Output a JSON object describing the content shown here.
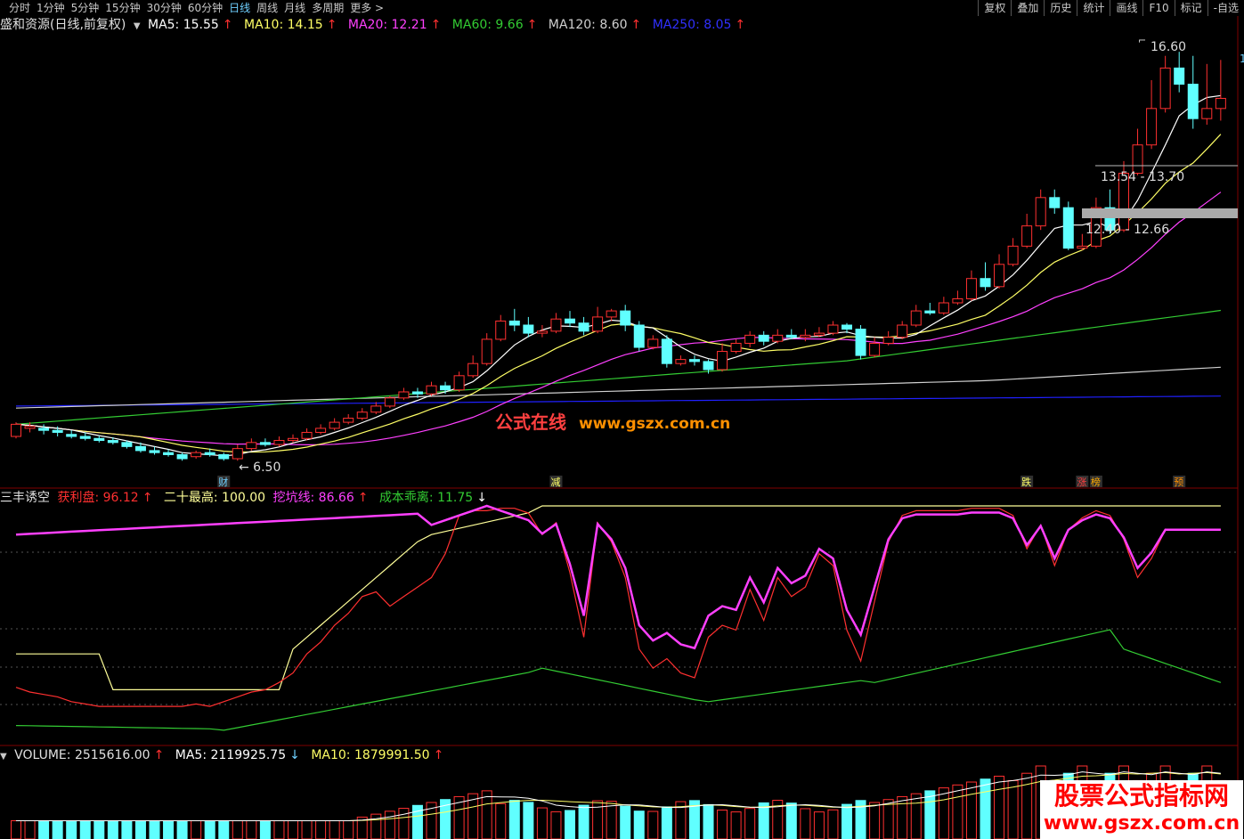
{
  "toolbar": {
    "periods": [
      "分时",
      "1分钟",
      "5分钟",
      "15分钟",
      "30分钟",
      "60分钟",
      "日线",
      "周线",
      "月线",
      "多周期",
      "更多"
    ],
    "active_period": "日线",
    "more_arrow": ">",
    "tools": [
      "复权",
      "叠加",
      "历史",
      "统计",
      "画线",
      "F10",
      "标记",
      "-自选"
    ]
  },
  "main_legend": {
    "title": "盛和资源(日线,前复权)",
    "ma5": "MA5: 15.55",
    "ma10": "MA10: 14.15",
    "ma20": "MA20: 12.21",
    "ma60": "MA60: 9.66",
    "ma120": "MA120: 8.60",
    "ma250": "MA250: 8.05",
    "arrow": "↑",
    "colors": {
      "ma5": "#ffffff",
      "ma10": "#ffff66",
      "ma20": "#ff40ff",
      "ma60": "#33cc33",
      "ma120": "#d0d0d0",
      "ma250": "#2020ff",
      "up": "#ff3030",
      "down": "#60ffff"
    }
  },
  "annotations": {
    "high": "16.60",
    "low": "6.50",
    "zone1": "13.54 - 13.70",
    "zone2": "12.40 - 12.66",
    "tags": [
      "财",
      "减",
      "跌",
      "涨",
      "榜",
      "预"
    ],
    "right_edge": "1"
  },
  "sub_legend": {
    "name": "三丰诱空",
    "profit": "获利盘: 96.12",
    "top20": "二十最高: 100.00",
    "pit": "挖坑线: 86.66",
    "cost": "成本乖离: 11.75",
    "up_arrow": "↑",
    "down_arrow": "↓"
  },
  "vol_legend": {
    "vol": "VOLUME: 2515616.00",
    "ma5": "MA5: 2119925.75",
    "ma10": "MA10: 1879991.50",
    "up_arrow": "↑",
    "down_arrow": "↓"
  },
  "watermarks": {
    "center_cn": "公式在线",
    "center_url": "www.gszx.com.cn",
    "corner_cn": "股票公式指标网",
    "corner_url": "www.gszx.com.cn"
  },
  "chart_data": {
    "type": "candlestick",
    "price_range": [
      6.0,
      17.0
    ],
    "candles": [
      [
        7.1,
        7.4,
        7.45,
        7.05
      ],
      [
        7.3,
        7.35,
        7.45,
        7.2
      ],
      [
        7.3,
        7.25,
        7.4,
        7.15
      ],
      [
        7.25,
        7.2,
        7.35,
        7.1
      ],
      [
        7.15,
        7.1,
        7.25,
        7.05
      ],
      [
        7.1,
        7.05,
        7.2,
        7.0
      ],
      [
        7.05,
        7.0,
        7.12,
        6.95
      ],
      [
        7.0,
        6.95,
        7.08,
        6.9
      ],
      [
        6.95,
        6.85,
        7.0,
        6.8
      ],
      [
        6.85,
        6.75,
        6.95,
        6.7
      ],
      [
        6.75,
        6.7,
        6.85,
        6.65
      ],
      [
        6.7,
        6.65,
        6.78,
        6.6
      ],
      [
        6.65,
        6.55,
        6.7,
        6.5
      ],
      [
        6.6,
        6.7,
        6.75,
        6.55
      ],
      [
        6.7,
        6.65,
        6.8,
        6.6
      ],
      [
        6.65,
        6.55,
        6.7,
        6.5
      ],
      [
        6.55,
        6.8,
        6.9,
        6.5
      ],
      [
        6.8,
        6.95,
        7.05,
        6.75
      ],
      [
        6.95,
        6.9,
        7.05,
        6.85
      ],
      [
        6.9,
        7.0,
        7.1,
        6.85
      ],
      [
        7.0,
        7.05,
        7.15,
        6.95
      ],
      [
        7.05,
        7.2,
        7.3,
        7.0
      ],
      [
        7.2,
        7.3,
        7.4,
        7.15
      ],
      [
        7.3,
        7.45,
        7.55,
        7.25
      ],
      [
        7.45,
        7.55,
        7.65,
        7.4
      ],
      [
        7.55,
        7.7,
        7.8,
        7.5
      ],
      [
        7.7,
        7.85,
        7.95,
        7.65
      ],
      [
        7.85,
        8.05,
        8.1,
        7.8
      ],
      [
        8.05,
        8.2,
        8.3,
        8.0
      ],
      [
        8.2,
        8.15,
        8.3,
        8.05
      ],
      [
        8.15,
        8.35,
        8.45,
        8.1
      ],
      [
        8.35,
        8.25,
        8.45,
        8.15
      ],
      [
        8.25,
        8.6,
        8.7,
        8.2
      ],
      [
        8.6,
        8.9,
        9.1,
        8.55
      ],
      [
        8.9,
        9.5,
        9.65,
        8.85
      ],
      [
        9.5,
        9.95,
        10.1,
        9.45
      ],
      [
        9.95,
        9.85,
        10.25,
        9.7
      ],
      [
        9.85,
        9.65,
        10.05,
        9.55
      ],
      [
        9.65,
        9.7,
        9.85,
        9.55
      ],
      [
        9.7,
        10.0,
        10.15,
        9.65
      ],
      [
        10.0,
        9.9,
        10.2,
        9.8
      ],
      [
        9.9,
        9.7,
        10.05,
        9.6
      ],
      [
        9.7,
        10.05,
        10.3,
        9.65
      ],
      [
        10.05,
        10.2,
        10.25,
        9.95
      ],
      [
        10.2,
        9.85,
        10.35,
        9.7
      ],
      [
        9.85,
        9.3,
        9.95,
        9.2
      ],
      [
        9.3,
        9.5,
        9.6,
        9.25
      ],
      [
        9.5,
        8.9,
        9.6,
        8.8
      ],
      [
        8.9,
        9.0,
        9.1,
        8.85
      ],
      [
        9.0,
        8.95,
        9.1,
        8.85
      ],
      [
        8.95,
        8.75,
        9.0,
        8.65
      ],
      [
        8.75,
        9.2,
        9.4,
        8.7
      ],
      [
        9.2,
        9.4,
        9.5,
        9.15
      ],
      [
        9.4,
        9.6,
        9.7,
        9.3
      ],
      [
        9.6,
        9.45,
        9.7,
        9.35
      ],
      [
        9.45,
        9.6,
        9.75,
        9.4
      ],
      [
        9.6,
        9.55,
        9.75,
        9.5
      ],
      [
        9.55,
        9.6,
        9.75,
        9.45
      ],
      [
        9.6,
        9.65,
        9.8,
        9.55
      ],
      [
        9.65,
        9.85,
        9.95,
        9.6
      ],
      [
        9.85,
        9.75,
        9.9,
        9.65
      ],
      [
        9.75,
        9.1,
        9.85,
        9.0
      ],
      [
        9.1,
        9.4,
        9.55,
        9.05
      ],
      [
        9.4,
        9.55,
        9.7,
        9.35
      ],
      [
        9.55,
        9.85,
        9.95,
        9.5
      ],
      [
        9.85,
        10.2,
        10.35,
        9.8
      ],
      [
        10.2,
        10.15,
        10.4,
        10.1
      ],
      [
        10.15,
        10.4,
        10.55,
        10.1
      ],
      [
        10.4,
        10.5,
        10.7,
        10.35
      ],
      [
        10.5,
        11.0,
        11.2,
        10.45
      ],
      [
        11.0,
        10.8,
        11.4,
        10.7
      ],
      [
        10.8,
        11.35,
        11.6,
        10.75
      ],
      [
        11.35,
        11.8,
        12.0,
        11.3
      ],
      [
        11.8,
        12.3,
        12.6,
        11.75
      ],
      [
        12.3,
        13.0,
        13.2,
        12.2
      ],
      [
        13.0,
        12.75,
        13.2,
        12.6
      ],
      [
        12.75,
        11.75,
        12.9,
        11.7
      ],
      [
        11.75,
        11.8,
        12.1,
        11.7
      ],
      [
        11.8,
        12.75,
        13.0,
        11.75
      ],
      [
        12.75,
        12.2,
        13.2,
        12.1
      ],
      [
        12.2,
        13.6,
        13.9,
        12.15
      ],
      [
        13.6,
        14.3,
        14.7,
        13.55
      ],
      [
        14.3,
        15.2,
        15.9,
        14.2
      ],
      [
        15.2,
        16.2,
        16.5,
        15.1
      ],
      [
        16.2,
        15.8,
        16.6,
        15.6
      ],
      [
        15.8,
        14.95,
        16.5,
        14.7
      ],
      [
        14.95,
        15.2,
        16.3,
        14.8
      ],
      [
        15.2,
        15.45,
        16.4,
        14.9
      ]
    ],
    "tag_positions": [
      15,
      39,
      73,
      77,
      78,
      84
    ],
    "sub_range": [
      0,
      100
    ],
    "volume_sample": "2515616.00"
  }
}
